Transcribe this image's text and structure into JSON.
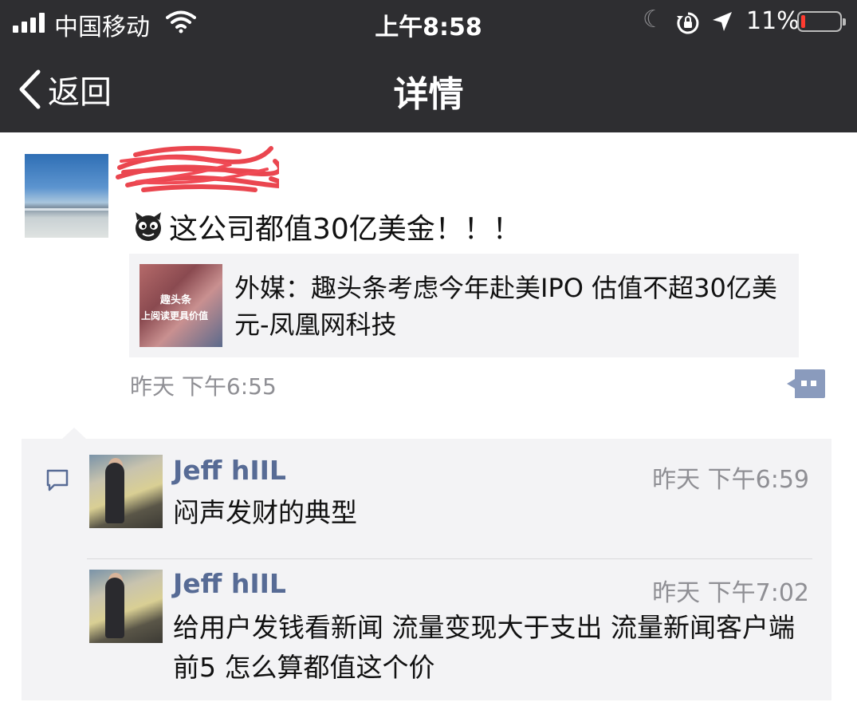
{
  "status_bar": {
    "carrier": "中国移动",
    "time": "上午8:58",
    "battery_percent": "11%",
    "battery_level": 0.11,
    "battery_color": "#ff3b30"
  },
  "nav": {
    "back_label": "返回",
    "title": "详情"
  },
  "post": {
    "author": "",
    "text": "这公司都值30亿美金！！！",
    "emoji": "devil-emoji",
    "link_card": {
      "thumb_line1": "趣头条",
      "thumb_line2": "上阅读更具价值",
      "title": "外媒：趣头条考虑今年赴美IPO 估值不超30亿美元-凤凰网科技"
    },
    "time": "昨天 下午6:55"
  },
  "comments": [
    {
      "name": "Jeff hIIL",
      "time": "昨天 下午6:59",
      "text": "闷声发财的典型"
    },
    {
      "name": "Jeff hIIL",
      "time": "昨天 下午7:02",
      "text": "给用户发钱看新闻 流量变现大于支出 流量新闻客户端前5 怎么算都值这个价"
    }
  ],
  "colors": {
    "header_bg": "#2e2e31",
    "link_blue": "#576b95",
    "comment_bg": "#f3f3f5",
    "redaction": "#e8323c"
  }
}
